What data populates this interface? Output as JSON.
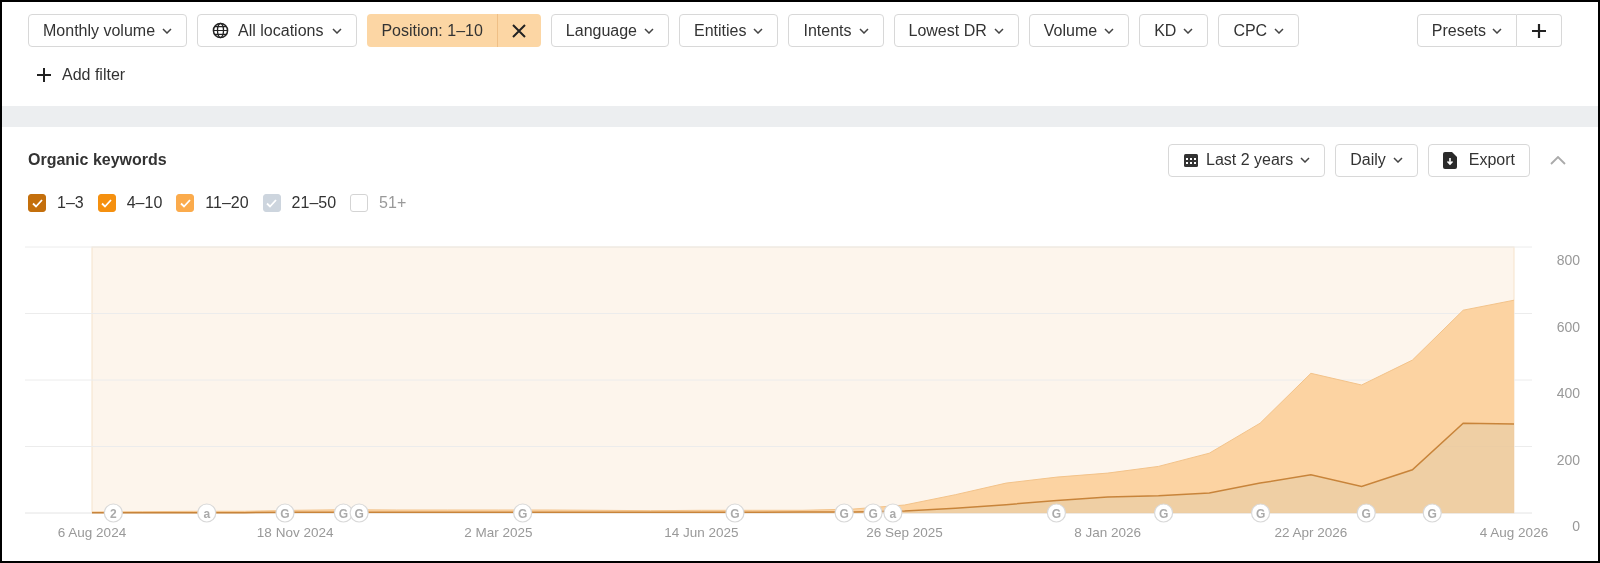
{
  "filters": [
    {
      "kind": "dropdown",
      "label": "Monthly volume"
    },
    {
      "kind": "location",
      "label": "All locations"
    },
    {
      "kind": "applied",
      "label": "Position: 1–10"
    },
    {
      "kind": "dropdown",
      "label": "Language"
    },
    {
      "kind": "dropdown",
      "label": "Entities"
    },
    {
      "kind": "dropdown",
      "label": "Intents"
    },
    {
      "kind": "dropdown",
      "label": "Lowest DR"
    },
    {
      "kind": "dropdown",
      "label": "Volume"
    },
    {
      "kind": "dropdown",
      "label": "KD"
    },
    {
      "kind": "dropdown",
      "label": "CPC"
    },
    {
      "kind": "add",
      "label": "Add filter"
    }
  ],
  "presets": {
    "label": "Presets"
  },
  "panel": {
    "title": "Organic keywords",
    "toolbar": [
      {
        "kind": "period",
        "label": "Last 2 years"
      },
      {
        "kind": "dropdown",
        "label": "Daily"
      },
      {
        "kind": "export",
        "label": "Export"
      }
    ],
    "collapsed": false,
    "legend": [
      {
        "kind": "series",
        "checked": true,
        "color": "#c46f0c"
      },
      {
        "kind": "series",
        "checked": true,
        "color": "#f5900f"
      },
      {
        "label": "11–20",
        "checked": true,
        "color": "#fbab4c"
      },
      {
        "label": "21–50",
        "checked": true,
        "color": "#cdd5de"
      },
      {
        "label": "51+",
        "checked": false,
        "color": "#ffffff"
      }
    ],
    "event_markers": [
      {
        "text": "2"
      },
      {
        "text": "a"
      },
      {
        "text": "G"
      },
      {
        "text": "G"
      },
      {
        "text": "G"
      },
      {
        "text": "G"
      },
      {
        "text": "G"
      },
      {
        "text": "G"
      },
      {
        "text": "G"
      },
      {
        "text": "a"
      },
      {
        "text": "G"
      },
      {
        "text": "G"
      },
      {
        "text": "G"
      },
      {
        "text": "G"
      },
      {
        "text": "G"
      }
    ],
    "chart_data": {
      "type": "area",
      "stacked": true,
      "grid": true,
      "categories": [
        "6 Aug 2024",
        null,
        null,
        null,
        "18 Nov 2024",
        null,
        null,
        null,
        "2 Mar 2025",
        null,
        null,
        null,
        "14 Jun 2025",
        null,
        null,
        null,
        "26 Sep 2025",
        null,
        null,
        null,
        "8 Jan 2026",
        null,
        null,
        null,
        "22 Apr 2026",
        null,
        null,
        null,
        "4 Aug 2026"
      ],
      "series": [
        {
          "name": "1–3",
          "color": "#c8843a",
          "values": [
            1,
            1,
            1,
            1,
            2,
            2,
            2,
            2,
            2,
            2,
            2,
            2,
            2,
            2,
            3,
            3,
            6,
            14,
            25,
            38,
            48,
            52,
            60,
            90,
            115,
            80,
            130,
            270,
            268
          ]
        },
        {
          "name": "4–10",
          "color": "#fcd3a2",
          "values": [
            2,
            3,
            4,
            4,
            6,
            8,
            7,
            7,
            7,
            7,
            6,
            5,
            6,
            6,
            5,
            9,
            18,
            41,
            65,
            70,
            72,
            88,
            120,
            180,
            305,
            305,
            330,
            340,
            372
          ]
        }
      ],
      "ylim": [
        0,
        800
      ],
      "yticks": [
        0,
        200,
        400,
        600,
        800
      ]
    }
  }
}
